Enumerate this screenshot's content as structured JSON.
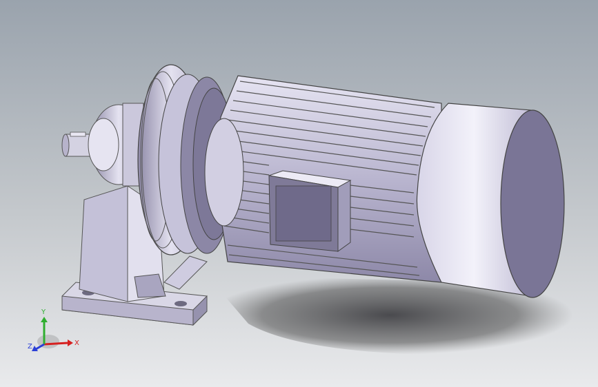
{
  "viewport": {
    "background_top": "#9aa3ad",
    "background_bottom": "#e9eaec"
  },
  "model": {
    "part_color": "#c9c6dc",
    "shade_color": "#7f7a98"
  },
  "triad": {
    "x_label": "X",
    "y_label": "Y",
    "z_label": "Z",
    "x_color": "#d62020",
    "y_color": "#2fae2f",
    "z_color": "#2b3fd6"
  }
}
